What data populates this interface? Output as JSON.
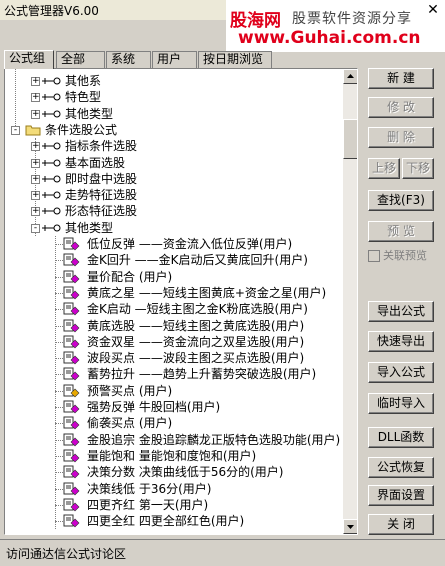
{
  "window": {
    "title": "公式管理器V6.00",
    "close_glyph": "✕"
  },
  "watermark": {
    "logo": "股海网",
    "subtitle": "股票软件资源分享",
    "url": "www.Guhai.com.cn"
  },
  "tabs": [
    {
      "label": "公式组",
      "active": true
    },
    {
      "label": "全部",
      "active": false
    },
    {
      "label": "系统",
      "active": false
    },
    {
      "label": "用户",
      "active": false
    },
    {
      "label": "按日期浏览",
      "active": false
    }
  ],
  "tree": {
    "rows": [
      {
        "label": "其他系",
        "level": 1,
        "icon": "link",
        "expander": "+"
      },
      {
        "label": "特色型",
        "level": 1,
        "icon": "link",
        "expander": "+"
      },
      {
        "label": "其他类型",
        "level": 1,
        "icon": "link",
        "expander": "+"
      },
      {
        "label": "条件选股公式",
        "level": 0,
        "icon": "folder",
        "expander": "-"
      },
      {
        "label": "指标条件选股",
        "level": 1,
        "icon": "link",
        "expander": "+"
      },
      {
        "label": "基本面选股",
        "level": 1,
        "icon": "link",
        "expander": "+"
      },
      {
        "label": "即时盘中选股",
        "level": 1,
        "icon": "link",
        "expander": "+"
      },
      {
        "label": "走势特征选股",
        "level": 1,
        "icon": "link",
        "expander": "+"
      },
      {
        "label": "形态特征选股",
        "level": 1,
        "icon": "link",
        "expander": "+"
      },
      {
        "label": "其他类型",
        "level": 1,
        "icon": "link",
        "expander": "-"
      },
      {
        "label": "低位反弹   ——资金流入低位反弹(用户)",
        "level": 2,
        "icon": "page"
      },
      {
        "label": "金K回升   ——金K启动后又黄底回升(用户)",
        "level": 2,
        "icon": "page"
      },
      {
        "label": "量价配合   (用户)",
        "level": 2,
        "icon": "page"
      },
      {
        "label": "黄底之星   ——短线主图黄底+资金之星(用户)",
        "level": 2,
        "icon": "page"
      },
      {
        "label": "金K启动   —短线主图之金K粉底选股(用户)",
        "level": 2,
        "icon": "page"
      },
      {
        "label": "黄底选股   ——短线主图之黄底选股(用户)",
        "level": 2,
        "icon": "page"
      },
      {
        "label": "资金双星   ——资金流向之双星选股(用户)",
        "level": 2,
        "icon": "page"
      },
      {
        "label": "波段买点   ——波段主图之买点选股(用户)",
        "level": 2,
        "icon": "page"
      },
      {
        "label": "蓄势拉升   ——趋势上升蓄势突破选股(用户)",
        "level": 2,
        "icon": "page"
      },
      {
        "label": "预警买点   (用户)",
        "level": 2,
        "icon": "page-special"
      },
      {
        "label": "强势反弹   牛股回档(用户)",
        "level": 2,
        "icon": "page"
      },
      {
        "label": "偷袭买点   (用户)",
        "level": 2,
        "icon": "page"
      },
      {
        "label": "金股追宗   金股追踪麟龙正版特色选股功能(用户)",
        "level": 2,
        "icon": "page"
      },
      {
        "label": "量能饱和   量能饱和度饱和(用户)",
        "level": 2,
        "icon": "page"
      },
      {
        "label": "决策分数   决策曲线低于56分的(用户)",
        "level": 2,
        "icon": "page"
      },
      {
        "label": "决策线低   于36分(用户)",
        "level": 2,
        "icon": "page"
      },
      {
        "label": "四更齐红   第一天(用户)",
        "level": 2,
        "icon": "page"
      },
      {
        "label": "四更全红   四更全部红色(用户)",
        "level": 2,
        "icon": "page"
      }
    ]
  },
  "buttons": {
    "new": "新 建",
    "modify": "修 改",
    "delete": "删 除",
    "move_up": "上移",
    "move_down": "下移",
    "find": "查找(F3)",
    "preview": "预 览",
    "related_preview": "关联预览",
    "export": "导出公式",
    "quick_export": "快速导出",
    "import": "导入公式",
    "temp_import": "临时导入",
    "dll": "DLL函数",
    "restore": "公式恢复",
    "ui_settings": "界面设置",
    "close": "关 闭"
  },
  "status": {
    "text": "访问通达信公式讨论区"
  },
  "colors": {
    "window_bg": "#d4d0c8",
    "page_icon_magenta": "#cc00cc",
    "watermark_red": "#e0001b"
  }
}
